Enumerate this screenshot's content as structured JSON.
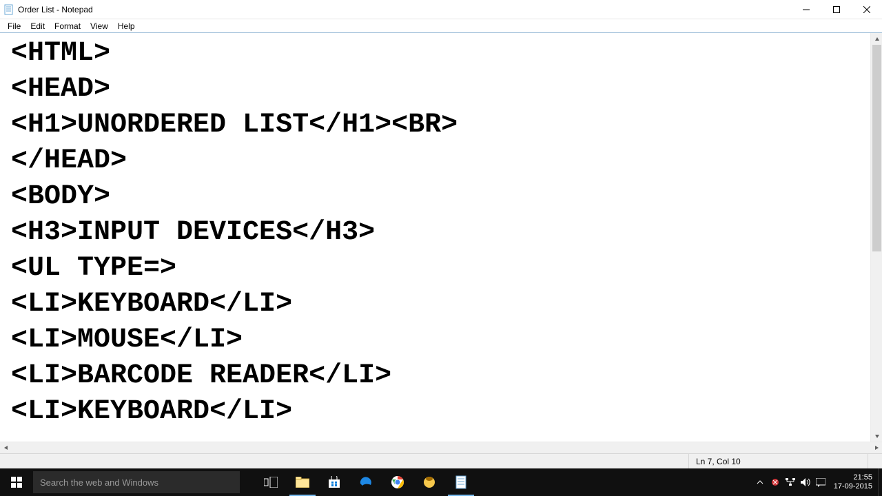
{
  "window": {
    "title": "Order List - Notepad"
  },
  "menu": {
    "items": [
      "File",
      "Edit",
      "Format",
      "View",
      "Help"
    ]
  },
  "editor": {
    "lines": [
      "<HTML>",
      "<HEAD>",
      "<H1>UNORDERED LIST</H1><BR>",
      "</HEAD>",
      "<BODY>",
      "<H3>INPUT DEVICES</H3>",
      "<UL TYPE=>",
      "<LI>KEYBOARD</LI>",
      "<LI>MOUSE</LI>",
      "<LI>BARCODE READER</LI>",
      "<LI>KEYBOARD</LI>"
    ]
  },
  "status": {
    "pos": "Ln 7, Col 10"
  },
  "taskbar": {
    "search_placeholder": "Search the web and Windows",
    "time": "21:55",
    "date": "17-09-2015"
  }
}
